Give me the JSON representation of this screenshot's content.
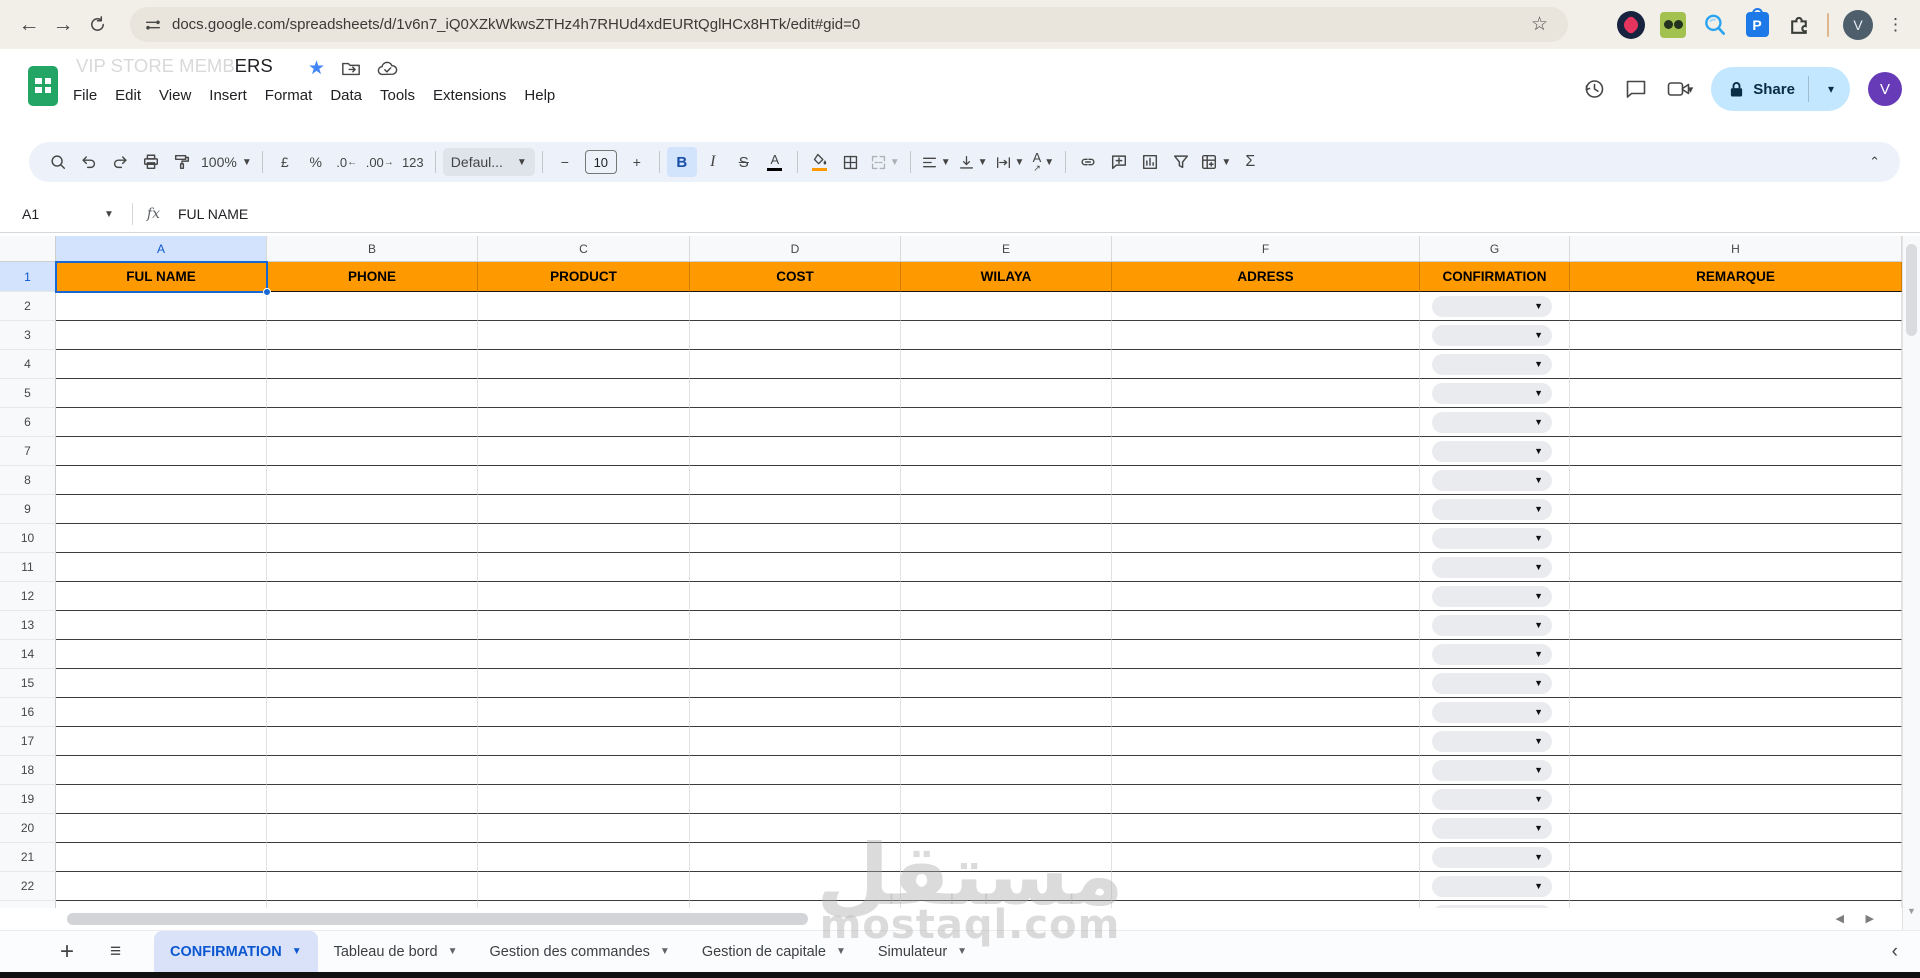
{
  "browser": {
    "url": "docs.google.com/spreadsheets/d/1v6n7_iQ0XZkWkwsZTHz4h7RHUd4xdEURtQglHCx8HTk/edit#gid=0",
    "profile_initial": "V",
    "menu_glyph": "⋮"
  },
  "app_header": {
    "title_full": "VIP STORE MEMBERS",
    "title_faded_part": "VIP STORE MEMB",
    "title_dark_part": "ERS",
    "menu_items": [
      "File",
      "Edit",
      "View",
      "Insert",
      "Format",
      "Data",
      "Tools",
      "Extensions",
      "Help"
    ],
    "share_label": "Share",
    "avatar_initial": "V"
  },
  "toolbar": {
    "zoom_value": "100%",
    "currency_symbol": "£",
    "percent_symbol": "%",
    "decrease_decimal_label": ".0",
    "increase_decimal_label": ".00",
    "number_format_label": "123",
    "font_name": "Defaul...",
    "font_size": "10",
    "bold_label": "B",
    "italic_label": "I",
    "strikethrough_label": "S",
    "text_color_label": "A",
    "text_rotation_label": "A",
    "minus_label": "−",
    "plus_label": "+",
    "sum_label": "Σ",
    "collapse_glyph": "⌃"
  },
  "formula_bar": {
    "cell_reference": "A1",
    "fx_label": "fx",
    "content": "FUL NAME"
  },
  "grid": {
    "column_letters": [
      "A",
      "B",
      "C",
      "D",
      "E",
      "F",
      "G",
      "H"
    ],
    "header_row": [
      "FUL NAME",
      "PHONE",
      "PRODUCT",
      "COST",
      "WILAYA",
      "ADRESS",
      "CONFIRMATION",
      "REMARQUE"
    ],
    "header_fill_color": "#ff9900",
    "visible_row_count": 23,
    "selected_cell": "A1",
    "selected_column": "A",
    "dropdown_column_letter": "G"
  },
  "sheet_tabs": {
    "add_glyph": "+",
    "all_sheets_glyph": "≡",
    "tabs": [
      {
        "label": "CONFIRMATION",
        "active": true
      },
      {
        "label": "Tableau de bord",
        "active": false
      },
      {
        "label": "Gestion des commandes",
        "active": false
      },
      {
        "label": "Gestion de capitale",
        "active": false
      },
      {
        "label": "Simulateur",
        "active": false
      }
    ]
  },
  "watermark": {
    "arabic_text": "مستقل",
    "latin_text": "mostaql.com"
  },
  "colors": {
    "header_orange": "#ff9900",
    "active_tab_blue": "#0b57d0",
    "selection_blue": "#1967d2",
    "share_button_bg": "#c2e7ff"
  }
}
